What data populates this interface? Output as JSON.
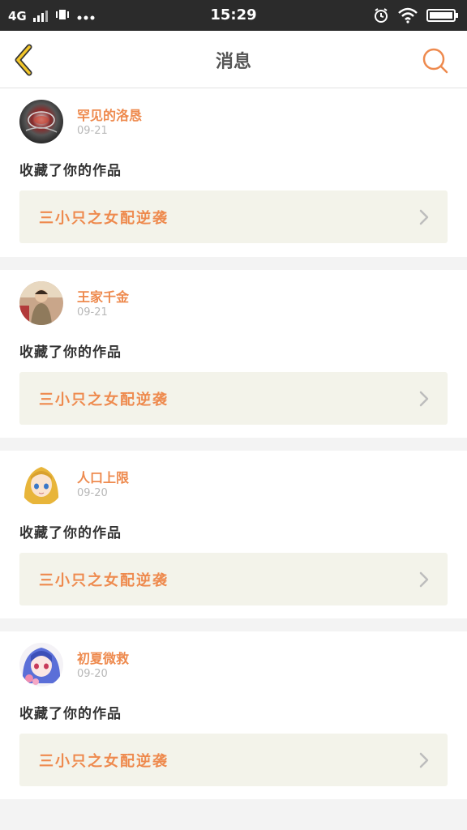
{
  "status_bar": {
    "network": "4G",
    "time": "15:29"
  },
  "header": {
    "title": "消息"
  },
  "notifications": [
    {
      "username": "罕见的洛恳",
      "date": "09-21",
      "action": "收藏了你的作品",
      "work_title": "三小只之女配逆袭",
      "avatar": "avatar-dark-swirl"
    },
    {
      "username": "王家千金",
      "date": "09-21",
      "action": "收藏了你的作品",
      "work_title": "三小只之女配逆袭",
      "avatar": "avatar-child-photo"
    },
    {
      "username": "人口上限",
      "date": "09-20",
      "action": "收藏了你的作品",
      "work_title": "三小只之女配逆袭",
      "avatar": "avatar-blonde-anime-girl"
    },
    {
      "username": "初夏微救",
      "date": "09-20",
      "action": "收藏了你的作品",
      "work_title": "三小只之女配逆袭",
      "avatar": "avatar-blue-hair-anime-girl"
    }
  ],
  "colors": {
    "accent_orange": "#ee8a4e",
    "back_yellow": "#f2c62a",
    "card_bg": "#f3f3ea"
  }
}
